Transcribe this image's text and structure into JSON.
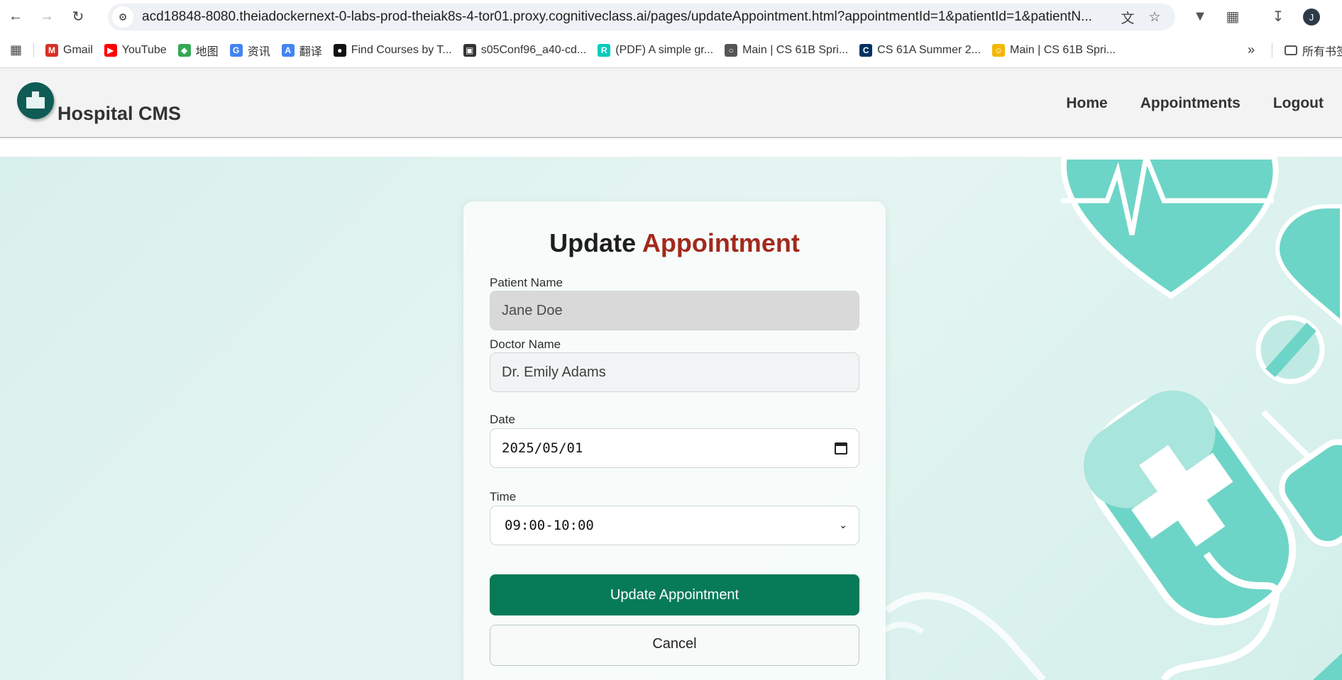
{
  "browser": {
    "url": "acd18848-8080.theiadockernext-0-labs-prod-theiak8s-4-tor01.proxy.cognitiveclass.ai/pages/updateAppointment.html?appointmentId=1&patientId=1&patientN...",
    "profile_initial": "J",
    "bookmarks": [
      {
        "label": "Gmail",
        "icon": "gmail-icon",
        "color": "#d93025"
      },
      {
        "label": "YouTube",
        "icon": "youtube-icon",
        "color": "#ff0000"
      },
      {
        "label": "地图",
        "icon": "maps-icon",
        "color": "#34a853"
      },
      {
        "label": "资讯",
        "icon": "news-icon",
        "color": "#4285f4"
      },
      {
        "label": "翻译",
        "icon": "translate-icon",
        "color": "#4285f4"
      },
      {
        "label": "Find Courses by T...",
        "icon": "courses-icon",
        "color": "#111111"
      },
      {
        "label": "s05Conf96_a40-cd...",
        "icon": "site-icon",
        "color": "#333333"
      },
      {
        "label": "(PDF) A simple gr...",
        "icon": "researchgate-icon",
        "color": "#00ccbb"
      },
      {
        "label": "Main | CS 61B Spri...",
        "icon": "globe-icon",
        "color": "#555555"
      },
      {
        "label": "CS 61A Summer 2...",
        "icon": "cal-icon",
        "color": "#003262"
      },
      {
        "label": "Main | CS 61B Spri...",
        "icon": "emoji-icon",
        "color": "#f2b705"
      }
    ],
    "all_bookmarks_label": "所有书签"
  },
  "header": {
    "brand": "Hospital CMS",
    "nav": [
      "Home",
      "Appointments",
      "Logout"
    ]
  },
  "form": {
    "title_part1": "Update",
    "title_part2": "Appointment",
    "patient_label": "Patient Name",
    "patient_value": "Jane Doe",
    "doctor_label": "Doctor Name",
    "doctor_value": "Dr. Emily Adams",
    "date_label": "Date",
    "date_value": "2025/05/01",
    "time_label": "Time",
    "time_value": "09:00-10:00",
    "submit_label": "Update Appointment",
    "cancel_label": "Cancel"
  },
  "colors": {
    "accent": "#a3291c",
    "primary_button": "#077a58",
    "logo": "#0e5c55",
    "deco": "#6dd5c7"
  }
}
